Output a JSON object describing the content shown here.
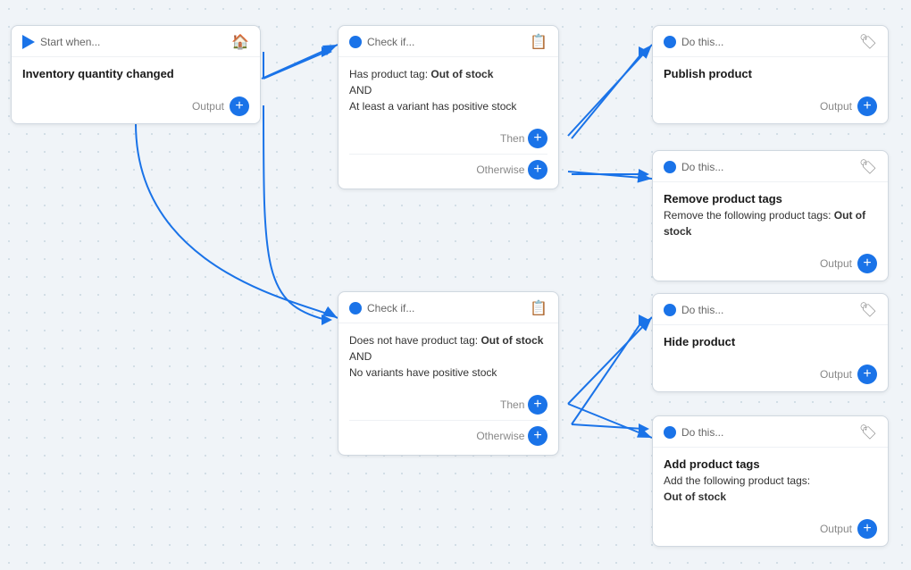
{
  "nodes": {
    "trigger": {
      "id": "trigger",
      "header_label": "Start when...",
      "main_text": "Inventory quantity changed",
      "footer_label": "Output",
      "icon": "🏠"
    },
    "check1": {
      "id": "check1",
      "header_label": "Check if...",
      "body_text_html": "Has product tag: <strong>Out of stock</strong><br>AND<br>At least a variant has positive stock",
      "then_label": "Then",
      "otherwise_label": "Otherwise",
      "icon": "📋"
    },
    "do1": {
      "id": "do1",
      "header_label": "Do this...",
      "main_text": "Publish product",
      "footer_label": "Output",
      "icon": "🏷"
    },
    "do2": {
      "id": "do2",
      "header_label": "Do this...",
      "main_text": "Remove product tags",
      "sub_text_html": "Remove the following product tags: <strong>Out of stock</strong>",
      "footer_label": "Output",
      "icon": "🏷"
    },
    "check2": {
      "id": "check2",
      "header_label": "Check if...",
      "body_text_html": "Does not have product tag: <strong>Out of stock</strong><br>AND<br>No variants have positive stock",
      "then_label": "Then",
      "otherwise_label": "Otherwise",
      "icon": "📋"
    },
    "do3": {
      "id": "do3",
      "header_label": "Do this...",
      "main_text": "Hide product",
      "footer_label": "Output",
      "icon": "🏷"
    },
    "do4": {
      "id": "do4",
      "header_label": "Do this...",
      "main_text": "Add product tags",
      "sub_text_html": "Add the following product tags:<br><strong>Out of stock</strong>",
      "footer_label": "Output",
      "icon": "🏷"
    }
  },
  "branch_labels": {
    "then1": "Then",
    "otherwise1": "Otherwise",
    "then2": "Then",
    "otherwise2": "Otherwise"
  },
  "colors": {
    "blue": "#1a73e8",
    "card_border": "#d0d8e0",
    "text_muted": "#888888"
  }
}
